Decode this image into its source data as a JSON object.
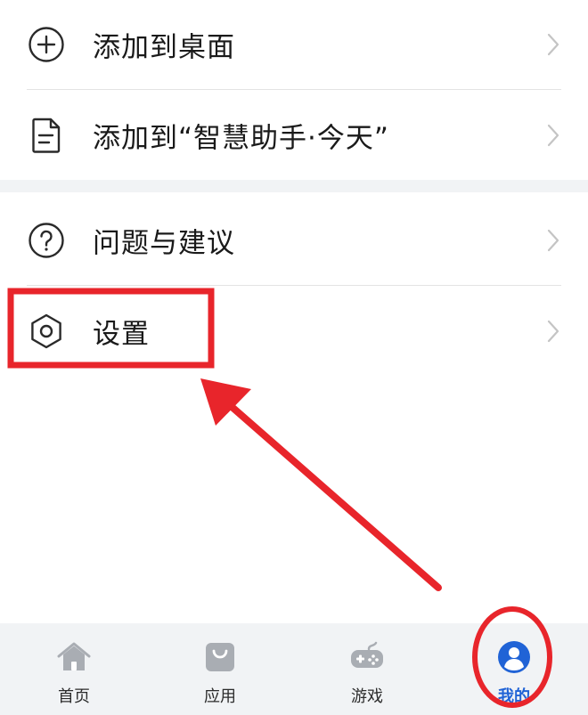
{
  "menu": {
    "group1": [
      {
        "label": "添加到桌面",
        "icon": "plus-circle-icon"
      },
      {
        "label": "添加到“智慧助手·今天”",
        "icon": "document-icon"
      }
    ],
    "group2": [
      {
        "label": "问题与建议",
        "icon": "question-circle-icon"
      },
      {
        "label": "设置",
        "icon": "gear-icon"
      }
    ]
  },
  "tabbar": {
    "tabs": [
      {
        "label": "首页",
        "icon": "home-icon"
      },
      {
        "label": "应用",
        "icon": "bag-icon"
      },
      {
        "label": "游戏",
        "icon": "gamepad-icon"
      },
      {
        "label": "我的",
        "icon": "profile-icon"
      }
    ],
    "active_index": 3
  },
  "colors": {
    "accent": "#2063d6",
    "annotation_red": "#e8252b",
    "icon_gray": "#a9adb3",
    "text": "#1a1a1a"
  }
}
